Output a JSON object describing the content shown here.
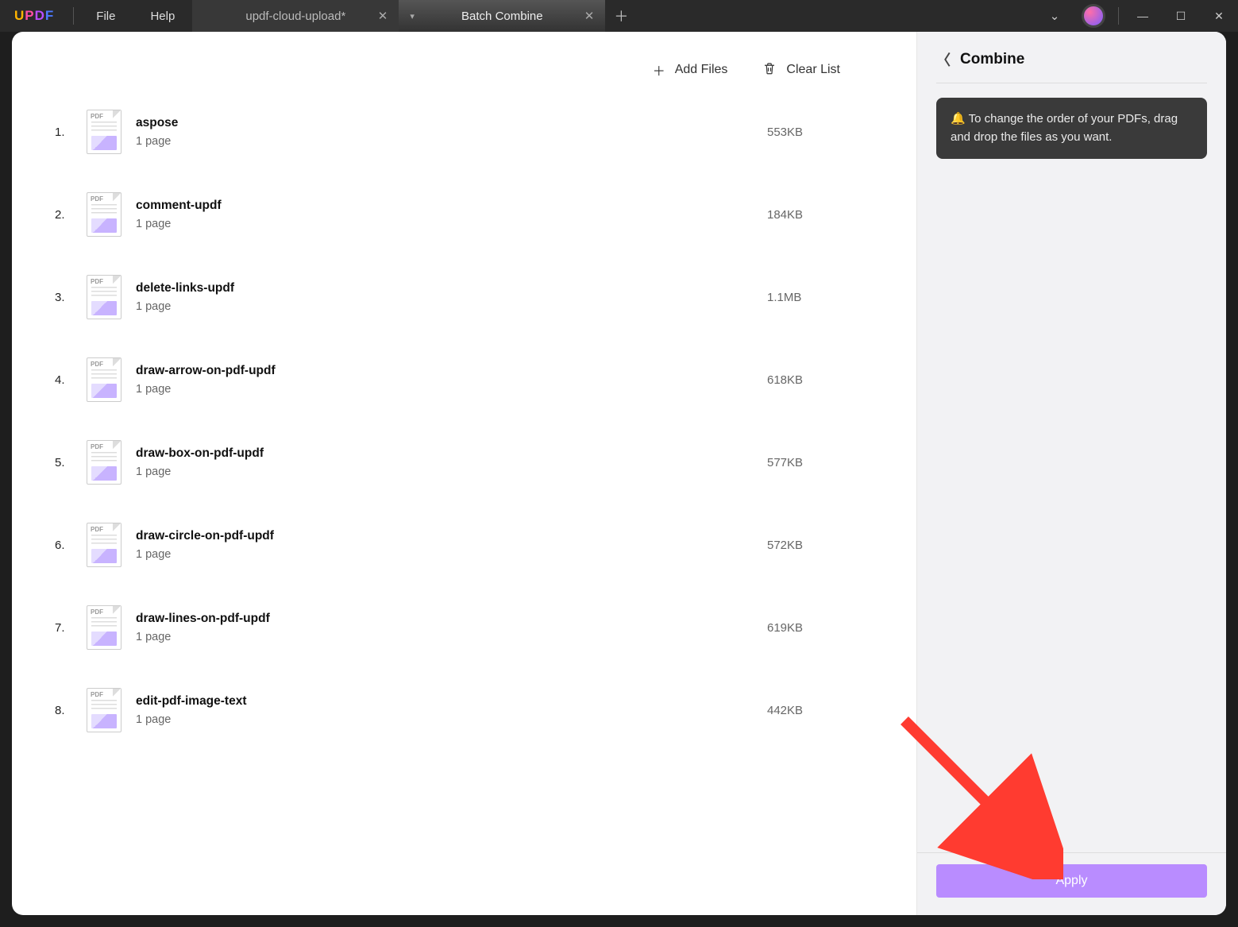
{
  "app": {
    "logo": "UPDF"
  },
  "menu": {
    "file": "File",
    "help": "Help"
  },
  "tabs": {
    "inactive": {
      "title": "updf-cloud-upload*"
    },
    "active": {
      "title": "Batch Combine"
    }
  },
  "toolbar": {
    "add_files": "Add Files",
    "clear_list": "Clear List"
  },
  "files": [
    {
      "num": "1.",
      "name": "aspose",
      "pages": "1 page",
      "size": "553KB"
    },
    {
      "num": "2.",
      "name": "comment-updf",
      "pages": "1 page",
      "size": "184KB"
    },
    {
      "num": "3.",
      "name": "delete-links-updf",
      "pages": "1 page",
      "size": "1.1MB"
    },
    {
      "num": "4.",
      "name": "draw-arrow-on-pdf-updf",
      "pages": "1 page",
      "size": "618KB"
    },
    {
      "num": "5.",
      "name": "draw-box-on-pdf-updf",
      "pages": "1 page",
      "size": "577KB"
    },
    {
      "num": "6.",
      "name": "draw-circle-on-pdf-updf",
      "pages": "1 page",
      "size": "572KB"
    },
    {
      "num": "7.",
      "name": "draw-lines-on-pdf-updf",
      "pages": "1 page",
      "size": "619KB"
    },
    {
      "num": "8.",
      "name": "edit-pdf-image-text",
      "pages": "1 page",
      "size": "442KB"
    }
  ],
  "side": {
    "title": "Combine",
    "tip_icon": "🔔",
    "tip": "To change the order of your PDFs, drag and drop the files as you want.",
    "apply": "Apply"
  }
}
